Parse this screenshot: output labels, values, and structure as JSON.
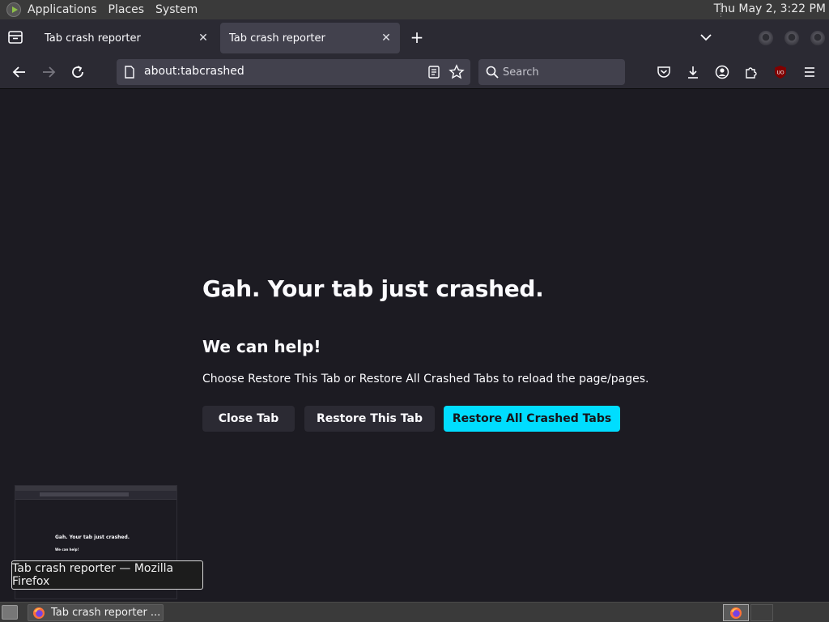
{
  "os_panel": {
    "menus": [
      "Applications",
      "Places",
      "System"
    ],
    "clock": "Thu May  2,  3:22 PM"
  },
  "tabs": [
    {
      "title": "Tab crash reporter"
    },
    {
      "title": "Tab crash reporter"
    }
  ],
  "urlbar": {
    "url": "about:tabcrashed"
  },
  "searchbar": {
    "placeholder": "Search"
  },
  "page": {
    "title": "Gah. Your tab just crashed.",
    "subtitle": "We can help!",
    "description": "Choose Restore This Tab or Restore All Crashed Tabs to reload the page/pages.",
    "buttons": {
      "close": "Close Tab",
      "restore": "Restore This Tab",
      "restore_all": "Restore All Crashed Tabs"
    }
  },
  "preview": {
    "title": "Gah. Your tab just crashed.",
    "subtitle": "We can help!"
  },
  "tooltip": "Tab crash reporter — Mozilla Firefox",
  "taskbar": {
    "item": "Tab crash reporter ..."
  },
  "colors": {
    "accent": "#00ddff",
    "content_bg": "#1c1b22",
    "toolbar_bg": "#2b2a33"
  }
}
